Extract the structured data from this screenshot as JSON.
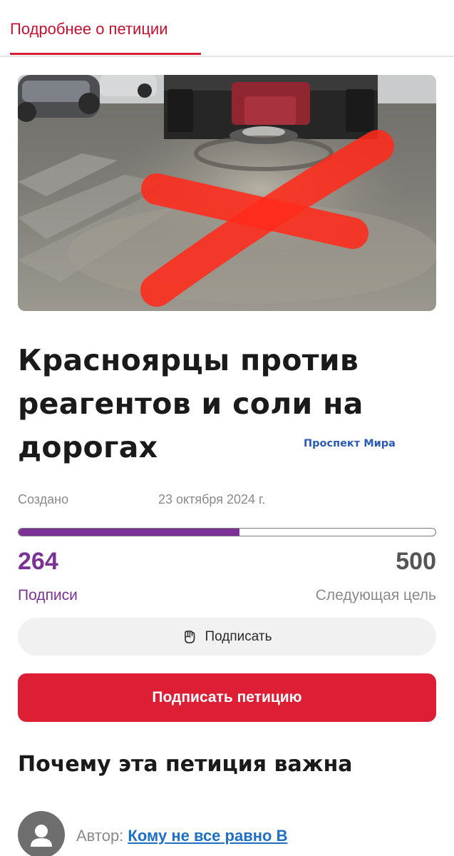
{
  "header": {
    "tab_label": "Подробнее о петиции"
  },
  "hero_image": {
    "description_icon": "road-salt-spreader-truck-crossed-out"
  },
  "petition": {
    "title": "Красноярцы против реагентов и соли на дорогах",
    "watermark": "Проспект Мира",
    "created_label": "Создано",
    "created_date": "23 октября 2024 г."
  },
  "progress": {
    "signatures": "264",
    "signatures_label": "Подписи",
    "goal": "500",
    "goal_label": "Следующая цель",
    "fraction": 0.53
  },
  "actions": {
    "sign_secondary_label": "Подписать",
    "sign_primary_label": "Подписать петицию"
  },
  "section": {
    "why_heading": "Почему эта петиция важна"
  },
  "author": {
    "prefix": "Автор:",
    "name": "Кому не все равно В"
  },
  "colors": {
    "accent_red": "#dd1e35",
    "progress_purple": "#7b3294",
    "link_blue": "#1f6fc5"
  }
}
